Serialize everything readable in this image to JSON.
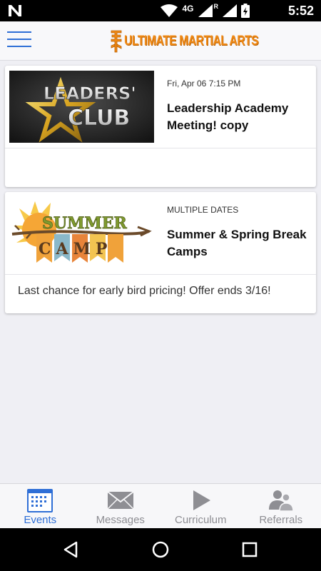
{
  "status_bar": {
    "network": "4G",
    "roaming": "R",
    "time": "5:52"
  },
  "app_bar": {
    "brand": "ULTIMATE MARTIAL ARTS",
    "brand_color": "#f08a16"
  },
  "events": [
    {
      "image_text": [
        "LEADERS'",
        "CLUB"
      ],
      "date": "Fri, Apr 06 7:15 PM",
      "title": "Leadership Academy Meeting! copy",
      "description": ""
    },
    {
      "image_text": [
        "SUMMER",
        "CAMP"
      ],
      "date": "MULTIPLE DATES",
      "title": "Summer & Spring Break Camps",
      "description": "Last chance for early bird pricing! Offer ends 3/16!"
    }
  ],
  "tabs": [
    {
      "label": "Events",
      "icon": "calendar-icon",
      "active": true
    },
    {
      "label": "Messages",
      "icon": "envelope-icon",
      "active": false
    },
    {
      "label": "Curriculum",
      "icon": "play-icon",
      "active": false
    },
    {
      "label": "Referrals",
      "icon": "people-icon",
      "active": false
    }
  ],
  "colors": {
    "accent": "#2f6fd6",
    "inactive": "#8e8e93",
    "background": "#efeff4"
  }
}
